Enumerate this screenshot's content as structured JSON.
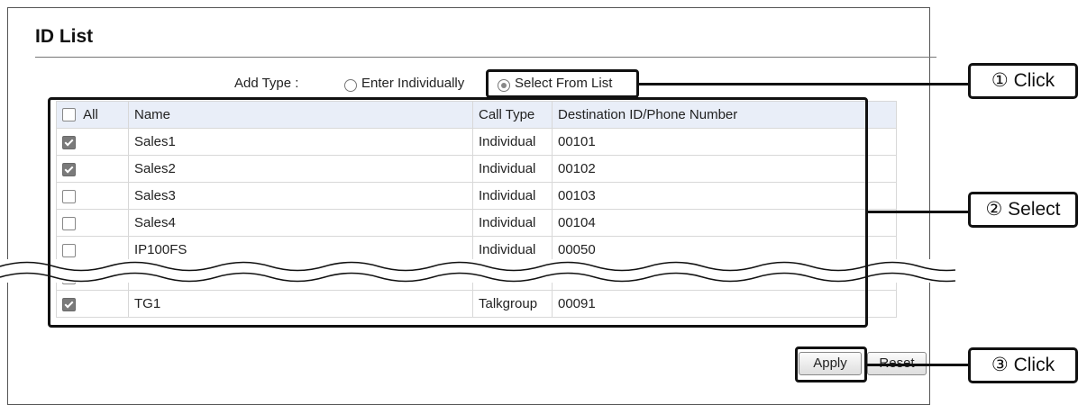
{
  "panel": {
    "title": "ID List"
  },
  "add_type": {
    "label": "Add Type :",
    "options": [
      "Enter Individually",
      "Select From List"
    ],
    "selected": "Select From List"
  },
  "table": {
    "header": {
      "all_label": "All",
      "name": "Name",
      "call_type": "Call Type",
      "dest": "Destination ID/Phone Number"
    },
    "rows": [
      {
        "checked": true,
        "name": "Sales1",
        "call_type": "Individual",
        "dest": "00101"
      },
      {
        "checked": true,
        "name": "Sales2",
        "call_type": "Individual",
        "dest": "00102"
      },
      {
        "checked": false,
        "name": "Sales3",
        "call_type": "Individual",
        "dest": "00103"
      },
      {
        "checked": false,
        "name": "Sales4",
        "call_type": "Individual",
        "dest": "00104"
      },
      {
        "checked": false,
        "name": "IP100FS",
        "call_type": "Individual",
        "dest": "00050"
      },
      {
        "checked": false,
        "name": "",
        "call_type": "",
        "dest": ""
      },
      {
        "checked": true,
        "name": "TG1",
        "call_type": "Talkgroup",
        "dest": "00091"
      }
    ]
  },
  "buttons": {
    "apply": "Apply",
    "reset": "Reset"
  },
  "callouts": {
    "c1": "① Click",
    "c2": "② Select",
    "c3": "③ Click"
  }
}
